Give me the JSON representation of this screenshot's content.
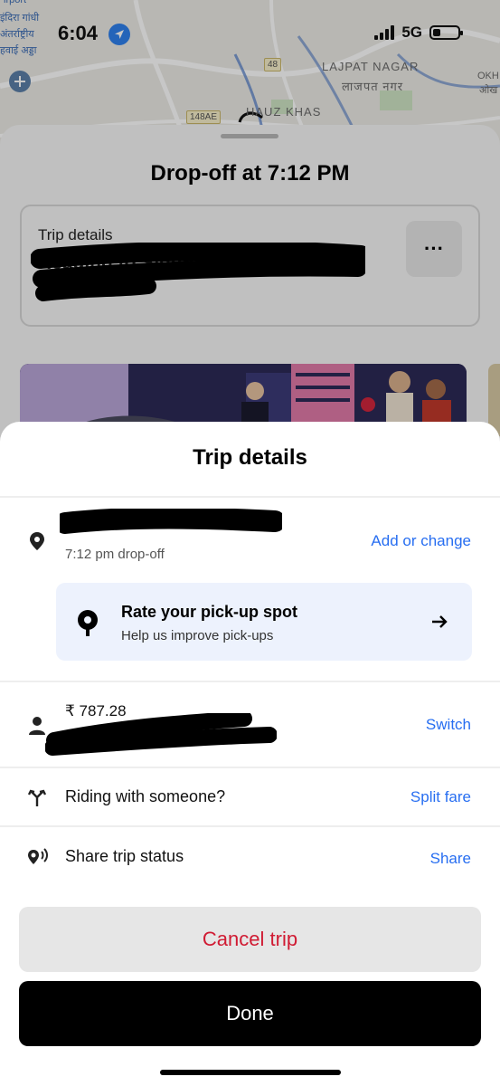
{
  "status_bar": {
    "time": "6:04",
    "network": "5G"
  },
  "map": {
    "labels": {
      "airport_en": "irport",
      "airport_hi_1": "इंदिरा गांधी",
      "airport_hi_2": "अंतर्राष्ट्रीय",
      "airport_hi_3": "हवाई अड्डा",
      "lajpat_en": "LAJPAT NAGAR",
      "lajpat_hi": "लाजपत नगर",
      "hauz_khas": "HAUZ KHAS",
      "okh_1": "OKH",
      "okh_2": "ओख"
    },
    "road_badges": {
      "r48": "48",
      "r148ae": "148AE"
    }
  },
  "background_sheet": {
    "dropoff_title": "Drop-off at 7:12 PM",
    "trip_card": {
      "label": "Trip details",
      "destination": "Heading to Siddhika Coatings Limited"
    },
    "more_icon": "ellipsis-icon"
  },
  "modal": {
    "title": "Trip details",
    "dropoff": {
      "name": "S",
      "time": "7:12 pm drop-off",
      "action": "Add or change"
    },
    "rate_pickup": {
      "title": "Rate your pick-up spot",
      "subtitle": "Help us improve pick-ups"
    },
    "payment": {
      "amount": "₹ 787.28",
      "action": "Switch"
    },
    "riding": {
      "label": "Riding with someone?",
      "action": "Split fare"
    },
    "share": {
      "label": "Share trip status",
      "action": "Share"
    },
    "cancel_label": "Cancel trip",
    "done_label": "Done"
  },
  "colors": {
    "link": "#276ef1",
    "cancel": "#d01b33",
    "location_arrow": "#2f80ed",
    "rate_card_bg": "#edf2fd"
  }
}
